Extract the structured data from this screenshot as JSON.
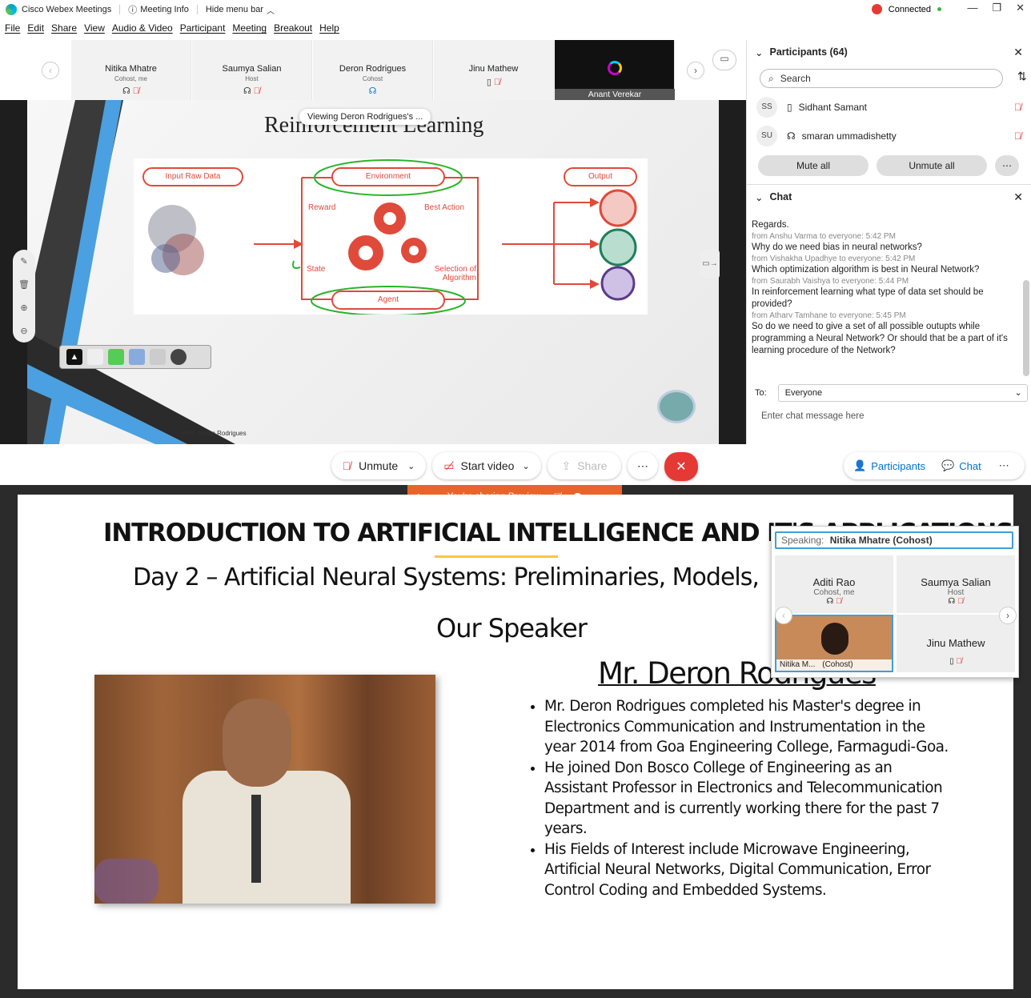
{
  "titlebar": {
    "app_name": "Cisco Webex Meetings",
    "meeting_info": "Meeting Info",
    "hide_menu": "Hide menu bar",
    "status": "Connected"
  },
  "menubar": [
    "File",
    "Edit",
    "Share",
    "View",
    "Audio & Video",
    "Participant",
    "Meeting",
    "Breakout",
    "Help"
  ],
  "thumbnails": [
    {
      "name": "Nitika Mhatre",
      "role": "Cohost, me"
    },
    {
      "name": "Saumya Salian",
      "role": "Host"
    },
    {
      "name": "Deron Rodrigues",
      "role": "Cohost"
    },
    {
      "name": "Jinu Mathew",
      "role": ""
    },
    {
      "name": "Anant Verekar",
      "role": ""
    }
  ],
  "slide": {
    "title": "Reinforcement Learning",
    "viewing_label": "Viewing Deron Rodrigues's ...",
    "boxes": {
      "input": "Input Raw Data",
      "environment": "Environment",
      "output": "Output",
      "agent": "Agent",
      "reward": "Reward",
      "best_action": "Best Action",
      "state": "State",
      "selection": "Selection of Algorithm"
    },
    "footer": "Prof. Deron Rodrigues"
  },
  "participants": {
    "header": "Participants (64)",
    "search_placeholder": "Search",
    "list": [
      {
        "initials": "SS",
        "name": "Sidhant Samant"
      },
      {
        "initials": "SU",
        "name": "smaran ummadishetty"
      }
    ],
    "mute_all": "Mute all",
    "unmute_all": "Unmute all"
  },
  "chat": {
    "header": "Chat",
    "messages": [
      {
        "from": "",
        "text": "Regards."
      },
      {
        "from": "from Anshu Varma to everyone:   5:42 PM",
        "text": "Why do we need bias in neural networks?"
      },
      {
        "from": "from Vishakha Upadhye to everyone:   5:42 PM",
        "text": "Which optimization algorithm is best in Neural Network?"
      },
      {
        "from": "from Saurabh Vaishya to everyone:   5:44 PM",
        "text": "In reinforcement learning what type of data set should be provided?"
      },
      {
        "from": "from Atharv Tamhane to everyone:   5:45 PM",
        "text": "So do we need to give a set of all possible outupts while programming a Neural Network? Or should that be a part of it's learning procedure of the Network?"
      }
    ],
    "to_label": "To:",
    "to_value": "Everyone",
    "input_placeholder": "Enter chat message here"
  },
  "controls": {
    "unmute": "Unmute",
    "start_video": "Start video",
    "share": "Share",
    "participants": "Participants",
    "chat": "Chat"
  },
  "share_bar": {
    "label": "You're sharing Preview"
  },
  "presentation": {
    "title": "INTRODUCTION TO ARTIFICIAL INTELLIGENCE AND IT'S APPLICATIONS",
    "subtitle": "Day 2  – Artificial Neural Systems: Preliminaries, Models,",
    "speaker_heading": "Our Speaker",
    "speaker_name": "Mr. Deron Rodrigues",
    "bullets": [
      "Mr. Deron Rodrigues completed his Master's degree in Electronics Communication and Instrumentation in the year 2014 from Goa Engineering College, Farmagudi-Goa.",
      "He joined Don Bosco College of Engineering as an Assistant Professor in Electronics and Telecommunication Department and is currently working there for the past 7 years.",
      "His Fields of Interest include Microwave Engineering, Artificial Neural Networks, Digital Communication, Error Control Coding and Embedded Systems."
    ]
  },
  "mini_panel": {
    "speaking_label": "Speaking:",
    "speaking_name": "Nitika Mhatre (Cohost)",
    "tiles": [
      {
        "name": "Aditi Rao",
        "role": "Cohost, me"
      },
      {
        "name": "Saumya Salian",
        "role": "Host"
      },
      {
        "name": "Nitika M...",
        "role": "(Cohost)"
      },
      {
        "name": "Jinu Mathew",
        "role": ""
      }
    ]
  },
  "colors": {
    "accent": "#e8642b",
    "end_call": "#e53935",
    "webex_blue": "#0070d2",
    "diagram_red": "#e04a3a"
  }
}
